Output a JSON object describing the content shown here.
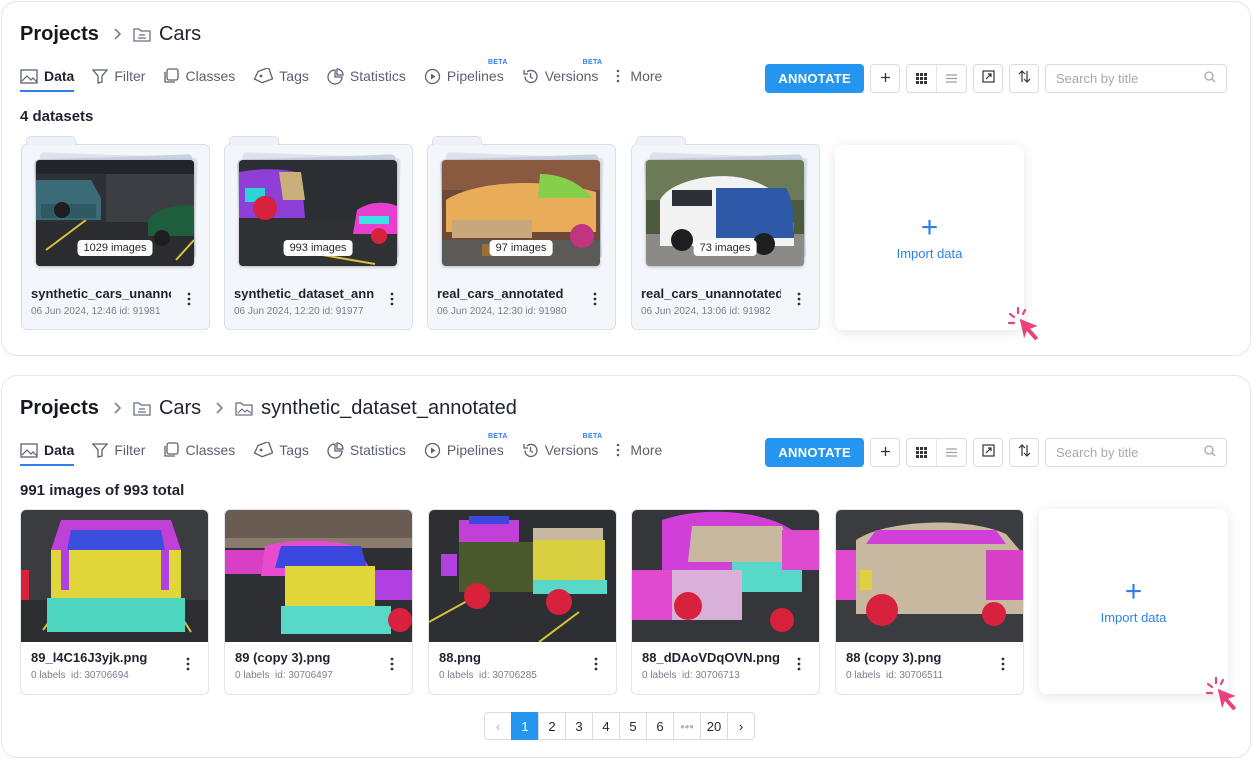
{
  "colors": {
    "accent": "#2496f0",
    "cursor": "#e8437c"
  },
  "top": {
    "breadcrumb": {
      "root": "Projects",
      "items": [
        "Cars"
      ]
    },
    "tabs": [
      {
        "label": "Data",
        "icon": "image-icon",
        "active": true
      },
      {
        "label": "Filter",
        "icon": "filter-icon"
      },
      {
        "label": "Classes",
        "icon": "classes-icon"
      },
      {
        "label": "Tags",
        "icon": "tag-icon"
      },
      {
        "label": "Statistics",
        "icon": "pie-chart-icon"
      },
      {
        "label": "Pipelines",
        "icon": "play-circle-icon",
        "badge": "BETA"
      },
      {
        "label": "Versions",
        "icon": "history-icon",
        "badge": "BETA"
      },
      {
        "label": "More",
        "icon": "more-vertical-icon"
      }
    ],
    "toolbar": {
      "annotate": "ANNOTATE",
      "search_placeholder": "Search by title"
    },
    "count": "4 datasets",
    "datasets": [
      {
        "title": "synthetic_cars_unannotated",
        "count": "1029 images",
        "meta": "06 Jun 2024, 12:46  id: 91981"
      },
      {
        "title": "synthetic_dataset_annotated",
        "count": "993 images",
        "meta": "06 Jun 2024, 12:20  id: 91977"
      },
      {
        "title": "real_cars_annotated",
        "count": "97 images",
        "meta": "06 Jun 2024, 12:30  id: 91980"
      },
      {
        "title": "real_cars_unannotated",
        "count": "73 images",
        "meta": "06 Jun 2024, 13:06  id: 91982"
      }
    ],
    "import": {
      "plus": "+",
      "label": "Import data"
    }
  },
  "bottom": {
    "breadcrumb": {
      "root": "Projects",
      "items": [
        "Cars",
        "synthetic_dataset_annotated"
      ]
    },
    "count": "991 images of 993 total",
    "images": [
      {
        "title": "89_l4C16J3yjk.png",
        "labels": "0 labels",
        "id": "id: 30706694"
      },
      {
        "title": "89 (copy 3).png",
        "labels": "0 labels",
        "id": "id: 30706497"
      },
      {
        "title": "88.png",
        "labels": "0 labels",
        "id": "id: 30706285"
      },
      {
        "title": "88_dDAoVDqOVN.png",
        "labels": "0 labels",
        "id": "id: 30706713"
      },
      {
        "title": "88 (copy 3).png",
        "labels": "0 labels",
        "id": "id: 30706511"
      }
    ],
    "import": {
      "plus": "+",
      "label": "Import data"
    },
    "pagination": {
      "prev": "‹",
      "pages": [
        "1",
        "2",
        "3",
        "4",
        "5",
        "6",
        "•••",
        "20"
      ],
      "active": "1",
      "next": "›"
    }
  }
}
